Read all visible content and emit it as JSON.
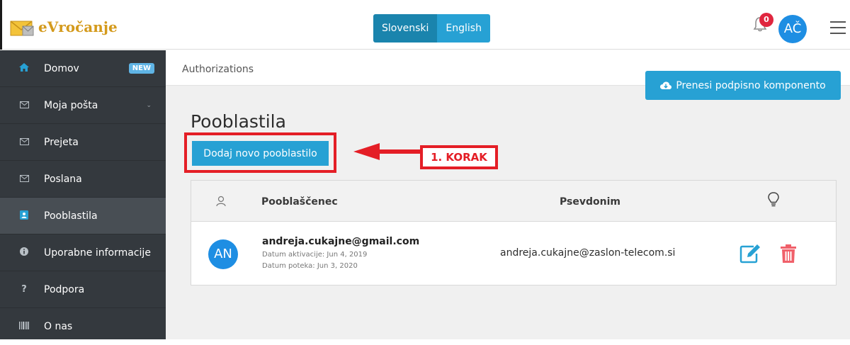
{
  "header": {
    "logo_text": "eVročanje",
    "languages": [
      "Slovenski",
      "English"
    ],
    "notification_count": "0",
    "user_initials": "AČ"
  },
  "sidebar": {
    "items": [
      {
        "label": "Domov",
        "icon": "home-icon",
        "badge": "NEW"
      },
      {
        "label": "Moja pošta",
        "icon": "envelope-icon"
      },
      {
        "label": "Prejeta",
        "icon": "envelope-icon"
      },
      {
        "label": "Poslana",
        "icon": "envelope-icon"
      },
      {
        "label": "Pooblastila",
        "icon": "contact-card-icon"
      },
      {
        "label": "Uporabne informacije",
        "icon": "info-icon"
      },
      {
        "label": "Podpora",
        "icon": "question-icon"
      },
      {
        "label": "O nas",
        "icon": "barcode-icon"
      }
    ]
  },
  "main": {
    "breadcrumb": "Authorizations",
    "download_button": "Prenesi podpisno komponento",
    "title": "Pooblastila",
    "add_button": "Dodaj novo pooblastilo",
    "step_label": "1. KORAK",
    "table": {
      "headers": [
        "Pooblaščenec",
        "Psevdonim"
      ],
      "rows": [
        {
          "initials": "AN",
          "email": "andreja.cukajne@gmail.com",
          "activation": "Datum aktivacije: Jun 4, 2019",
          "expiry": "Datum poteka: Jun 3, 2020",
          "pseudonym": "andreja.cukajne@zaslon-telecom.si"
        }
      ]
    }
  },
  "colors": {
    "accent": "#27a1d4",
    "sidebar_bg": "#34393e",
    "highlight_red": "#e41e26",
    "logo_gold": "#d49a1c"
  }
}
